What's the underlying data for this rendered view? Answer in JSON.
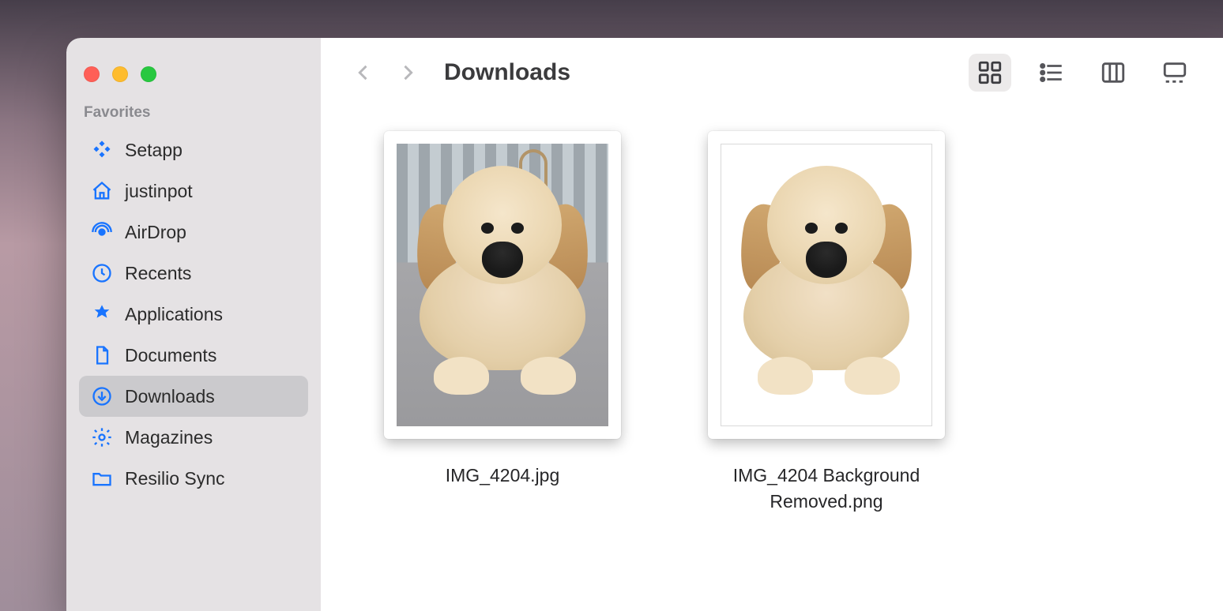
{
  "window": {
    "title": "Downloads"
  },
  "sidebar": {
    "section_title": "Favorites",
    "items": [
      {
        "label": "Setapp",
        "icon": "setapp"
      },
      {
        "label": "justinpot",
        "icon": "home"
      },
      {
        "label": "AirDrop",
        "icon": "airdrop"
      },
      {
        "label": "Recents",
        "icon": "clock"
      },
      {
        "label": "Applications",
        "icon": "apps"
      },
      {
        "label": "Documents",
        "icon": "document"
      },
      {
        "label": "Downloads",
        "icon": "download",
        "selected": true
      },
      {
        "label": "Magazines",
        "icon": "gear"
      },
      {
        "label": "Resilio Sync",
        "icon": "folder"
      }
    ]
  },
  "view_modes": {
    "active": "icon",
    "options": [
      "icon",
      "list",
      "column",
      "gallery"
    ]
  },
  "files": [
    {
      "name": "IMG_4204.jpg",
      "kind": "photo"
    },
    {
      "name": "IMG_4204 Background Removed.png",
      "kind": "cutout"
    }
  ]
}
